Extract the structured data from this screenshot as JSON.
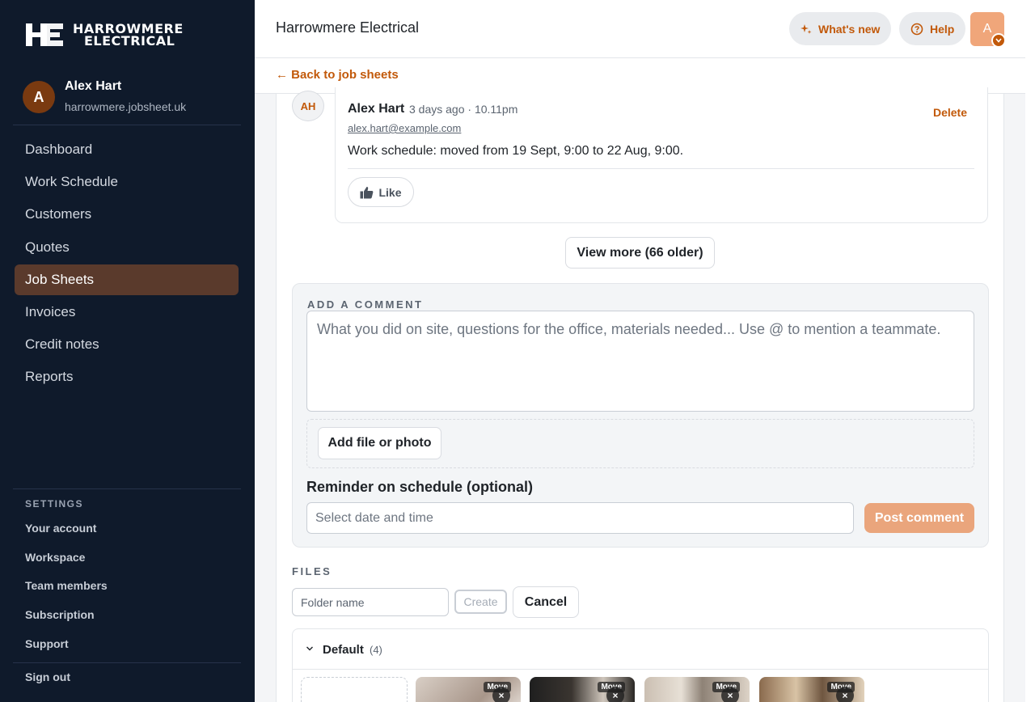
{
  "brand": {
    "logo_line1": "HARROWMERE",
    "logo_line2": "ELECTRICAL",
    "title": "Harrowmere Electrical"
  },
  "user": {
    "initial": "A",
    "name": "Alex Hart",
    "domain": "harrowmere.jobsheet.uk"
  },
  "nav": {
    "items": [
      {
        "label": "Dashboard"
      },
      {
        "label": "Work Schedule"
      },
      {
        "label": "Customers"
      },
      {
        "label": "Quotes"
      },
      {
        "label": "Job Sheets",
        "active": true
      },
      {
        "label": "Invoices"
      },
      {
        "label": "Credit notes"
      },
      {
        "label": "Reports"
      }
    ]
  },
  "settings": {
    "heading": "SETTINGS",
    "items": [
      {
        "label": "Your account"
      },
      {
        "label": "Workspace"
      },
      {
        "label": "Team members"
      },
      {
        "label": "Subscription"
      },
      {
        "label": "Support"
      }
    ],
    "signout": "Sign out"
  },
  "topbar": {
    "whats_new": "What's new",
    "help": "Help",
    "avatar_initial": "A"
  },
  "subbar": {
    "back": "← Back to job sheets"
  },
  "comment": {
    "avatar_initials": "AH",
    "author": "Alex Hart",
    "meta": "3 days ago · 10.11pm",
    "email": "alex.hart@example.com",
    "body": "Work schedule: moved from 19 Sept, 9:00 to 22 Aug, 9:00.",
    "delete": "Delete",
    "like": "Like"
  },
  "view_more": "View more (66 older)",
  "add_comment": {
    "heading": "ADD A COMMENT",
    "placeholder": "What you did on site, questions for the office, materials needed... Use @ to mention a teammate.",
    "add_file": "Add file or photo",
    "reminder_label": "Reminder on schedule (optional)",
    "date_placeholder": "Select date and time",
    "post": "Post comment"
  },
  "files": {
    "heading": "FILES",
    "folder_placeholder": "Folder name",
    "create": "Create",
    "cancel": "Cancel",
    "folder": {
      "name": "Default",
      "count": "(4)"
    },
    "thumbs": [
      {
        "move": "Move",
        "remove": "×"
      },
      {
        "move": "Move",
        "remove": "×"
      },
      {
        "move": "Move",
        "remove": "×"
      },
      {
        "move": "Move",
        "remove": "×"
      }
    ]
  },
  "colors": {
    "accent": "#c2590a",
    "sidebar": "#0f1a2b",
    "active_nav": "#5a3a2c",
    "post_button": "#eaa57c"
  }
}
